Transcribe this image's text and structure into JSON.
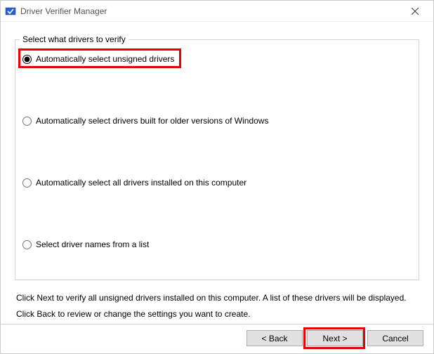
{
  "window": {
    "title": "Driver Verifier Manager"
  },
  "group": {
    "legend": "Select what drivers to verify",
    "options": [
      "Automatically select unsigned drivers",
      "Automatically select drivers built for older versions of Windows",
      "Automatically select all drivers installed on this computer",
      "Select driver names from a list"
    ]
  },
  "instructions": {
    "line1": "Click Next to verify all unsigned drivers installed on this computer. A list of these drivers will be displayed.",
    "line2": "Click Back to review or change the settings you want to create."
  },
  "buttons": {
    "back": "< Back",
    "next": "Next >",
    "cancel": "Cancel"
  }
}
